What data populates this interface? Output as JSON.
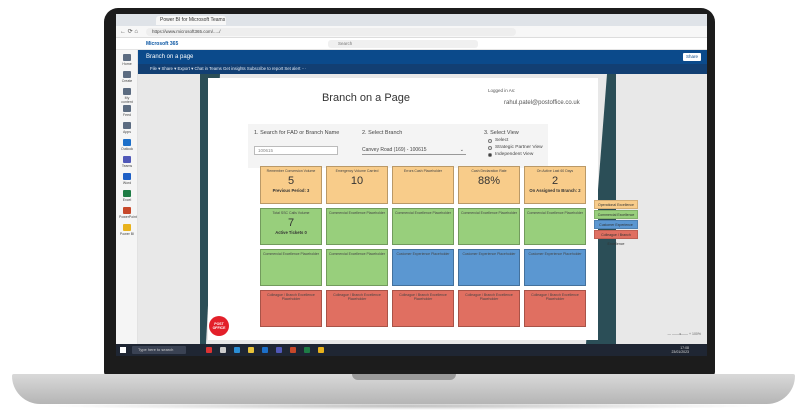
{
  "browser": {
    "tab_title": "Power BI for Microsoft Teams & ...",
    "url": "https://www.microsoft365.com/...../",
    "nav_glyphs": "←  ⟳  ⌂"
  },
  "m365": {
    "app_title": "Microsoft 365",
    "search_placeholder": "Search"
  },
  "left_rail": [
    {
      "label": "Home",
      "color": "#5b6b80"
    },
    {
      "label": "Create",
      "color": "#5b6b80"
    },
    {
      "label": "My content",
      "color": "#5b6b80"
    },
    {
      "label": "Feed",
      "color": "#5b6b80"
    },
    {
      "label": "Apps",
      "color": "#5b6b80"
    },
    {
      "label": "Outlook",
      "color": "#1c6fc9"
    },
    {
      "label": "Teams",
      "color": "#5058b8"
    },
    {
      "label": "Word",
      "color": "#1d5fc5"
    },
    {
      "label": "Excel",
      "color": "#1e7c45"
    },
    {
      "label": "PowerPoint",
      "color": "#c7482a"
    },
    {
      "label": "Power BI",
      "color": "#e8b21c"
    }
  ],
  "report": {
    "name": "Branch on a page",
    "share_label": "Share",
    "commands": "File ▾   Share ▾   Export ▾   Chat in Teams   Get insights   Subscribe to report   Set alert   ···"
  },
  "page": {
    "title": "Branch on a Page",
    "logged_in_label": "Logged in As:",
    "email": "rahul.patel@postoffice.co.uk",
    "filter1_label": "1. Search for FAD or Branch Name",
    "filter1_value": "100615",
    "filter2_label": "2. Select Branch",
    "filter2_value": "Canvey Road (169) - 100615",
    "filter3_label": "3. Select View",
    "views": [
      {
        "label": "Select",
        "selected": false
      },
      {
        "label": "Strategic Partner View",
        "selected": false
      },
      {
        "label": "Independent View",
        "selected": true
      }
    ]
  },
  "tiles": [
    {
      "title": "Remember Conversion Volume",
      "value": "5",
      "sub": "Previous Period: 3",
      "color": "orange"
    },
    {
      "title": "Emergency Volume Carried",
      "value": "10",
      "sub": "",
      "color": "orange"
    },
    {
      "title": "Errors Cash Placeholder",
      "value": "",
      "sub": "",
      "color": "orange"
    },
    {
      "title": "Cash Declaration Rate",
      "value": "88%",
      "sub": "",
      "color": "orange"
    },
    {
      "title": "On Active Last 60 Days",
      "value": "2",
      "sub": "On Assigned to Branch: 2",
      "color": "orange"
    },
    {
      "title": "Total SSC Calls Volume",
      "value": "7",
      "sub": "Active Tickets 0",
      "color": "green"
    },
    {
      "title": "Commercial Excellence Placeholder",
      "value": "",
      "sub": "",
      "color": "green"
    },
    {
      "title": "Commercial Excellence Placeholder",
      "value": "",
      "sub": "",
      "color": "green"
    },
    {
      "title": "Commercial Excellence Placeholder",
      "value": "",
      "sub": "",
      "color": "green"
    },
    {
      "title": "Commercial Excellence Placeholder",
      "value": "",
      "sub": "",
      "color": "green"
    },
    {
      "title": "Commercial Excellence Placeholder",
      "value": "",
      "sub": "",
      "color": "green"
    },
    {
      "title": "Commercial Excellence Placeholder",
      "value": "",
      "sub": "",
      "color": "green"
    },
    {
      "title": "Customer Experience Placeholder",
      "value": "",
      "sub": "",
      "color": "blue"
    },
    {
      "title": "Customer Experience Placeholder",
      "value": "",
      "sub": "",
      "color": "blue"
    },
    {
      "title": "Customer Experience Placeholder",
      "value": "",
      "sub": "",
      "color": "blue"
    },
    {
      "title": "Colleague / Branch Excellence Placeholder",
      "value": "",
      "sub": "",
      "color": "red"
    },
    {
      "title": "Colleague / Branch Excellence Placeholder",
      "value": "",
      "sub": "",
      "color": "red"
    },
    {
      "title": "Colleague / Branch Excellence Placeholder",
      "value": "",
      "sub": "",
      "color": "red"
    },
    {
      "title": "Colleague / Branch Excellence Placeholder",
      "value": "",
      "sub": "",
      "color": "red"
    },
    {
      "title": "Colleague / Branch Excellence Placeholder",
      "value": "",
      "sub": "",
      "color": "red"
    }
  ],
  "legend": [
    {
      "label": "Operational Excellence",
      "color": "#f8cc8a"
    },
    {
      "label": "Commercial Excellence",
      "color": "#98cf7c"
    },
    {
      "label": "Customer Experience",
      "color": "#5b97d1"
    },
    {
      "label": "Colleague / Branch Excellence",
      "color": "#e06f61"
    }
  ],
  "logo_text": "POST OFFICE",
  "zoom": "— ——●—— +  100%",
  "taskbar": {
    "search_placeholder": "Type here to search",
    "time": "17:08",
    "date": "23/01/2023"
  }
}
